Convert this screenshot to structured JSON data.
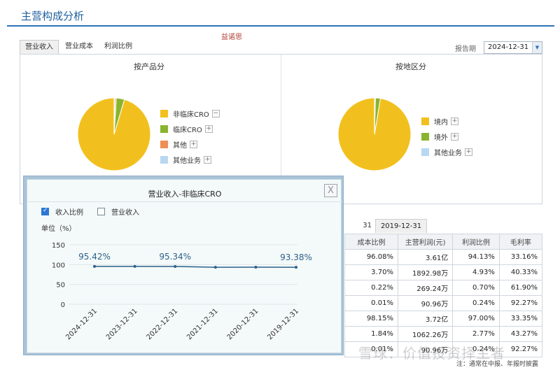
{
  "section": {
    "title": "主营构成分析"
  },
  "company": "益诺思",
  "tabs": [
    {
      "label": "营业收入"
    },
    {
      "label": "营业成本"
    },
    {
      "label": "利润比例"
    }
  ],
  "period": {
    "label": "报告期",
    "value": "2024-12-31"
  },
  "pie_by_product": {
    "title": "按产品分",
    "legend": [
      {
        "label": "非临床CRO",
        "toggle": "−",
        "color": "#f2c01e"
      },
      {
        "label": "临床CRO",
        "toggle": "+",
        "color": "#8ab42f"
      },
      {
        "label": "其他",
        "toggle": "+",
        "color": "#ee8f55"
      },
      {
        "label": "其他业务",
        "toggle": "+",
        "color": "#b8d8f2"
      }
    ]
  },
  "pie_by_region": {
    "title": "按地区分",
    "legend": [
      {
        "label": "境内",
        "toggle": "+",
        "color": "#f2c01e"
      },
      {
        "label": "境外",
        "toggle": "+",
        "color": "#8ab42f"
      },
      {
        "label": "其他业务",
        "toggle": "+",
        "color": "#b8d8f2"
      }
    ]
  },
  "table": {
    "partial_tab": "31",
    "active_tab": "2019-12-31",
    "headers": [
      "成本比例",
      "主营利润(元)",
      "利润比例",
      "毛利率"
    ],
    "rows": [
      [
        "96.08%",
        "3.61亿",
        "94.13%",
        "33.16%"
      ],
      [
        "3.70%",
        "1892.98万",
        "4.93%",
        "40.33%"
      ],
      [
        "0.22%",
        "269.24万",
        "0.70%",
        "61.90%"
      ],
      [
        "0.01%",
        "90.96万",
        "0.24%",
        "92.27%"
      ],
      [
        "98.15%",
        "3.72亿",
        "97.00%",
        "33.35%"
      ],
      [
        "1.84%",
        "1062.26万",
        "2.77%",
        "43.27%"
      ],
      [
        "0.01%",
        "90.96万",
        "0.24%",
        "92.27%"
      ]
    ]
  },
  "watermark": "雪球：价值投资择主者",
  "footnote": "注：通常在中报、年报时披露",
  "popup": {
    "title": "营业收入-非临床CRO",
    "close": "X",
    "checks": [
      {
        "label": "收入比例",
        "checked": true
      },
      {
        "label": "营业收入",
        "checked": false
      }
    ],
    "unit": "单位（%）"
  },
  "chart_data": [
    {
      "type": "pie",
      "title": "按产品分",
      "categories": [
        "非临床CRO",
        "临床CRO",
        "其他",
        "其他业务"
      ],
      "values": [
        95.42,
        3.6,
        0.6,
        0.38
      ],
      "colors": [
        "#f2c01e",
        "#8ab42f",
        "#ee8f55",
        "#b8d8f2"
      ]
    },
    {
      "type": "pie",
      "title": "按地区分",
      "categories": [
        "境内",
        "境外",
        "其他业务"
      ],
      "values": [
        97.4,
        2.2,
        0.4
      ],
      "colors": [
        "#f2c01e",
        "#8ab42f",
        "#b8d8f2"
      ]
    },
    {
      "type": "line",
      "title": "营业收入-非临床CRO",
      "categories": [
        "2024-12-31",
        "2023-12-31",
        "2022-12-31",
        "2021-12-31",
        "2020-12-31",
        "2019-12-31"
      ],
      "values": [
        95.42,
        95.5,
        95.34,
        93.4,
        93.5,
        93.38
      ],
      "data_labels": [
        {
          "index": 0,
          "text": "95.42%"
        },
        {
          "index": 2,
          "text": "95.34%"
        },
        {
          "index": 5,
          "text": "93.38%"
        }
      ],
      "yticks": [
        0,
        50,
        100,
        150
      ],
      "ylim": [
        0,
        150
      ],
      "ylabel": "单位（%）",
      "color": "#2c5f8a",
      "grid": true
    }
  ]
}
